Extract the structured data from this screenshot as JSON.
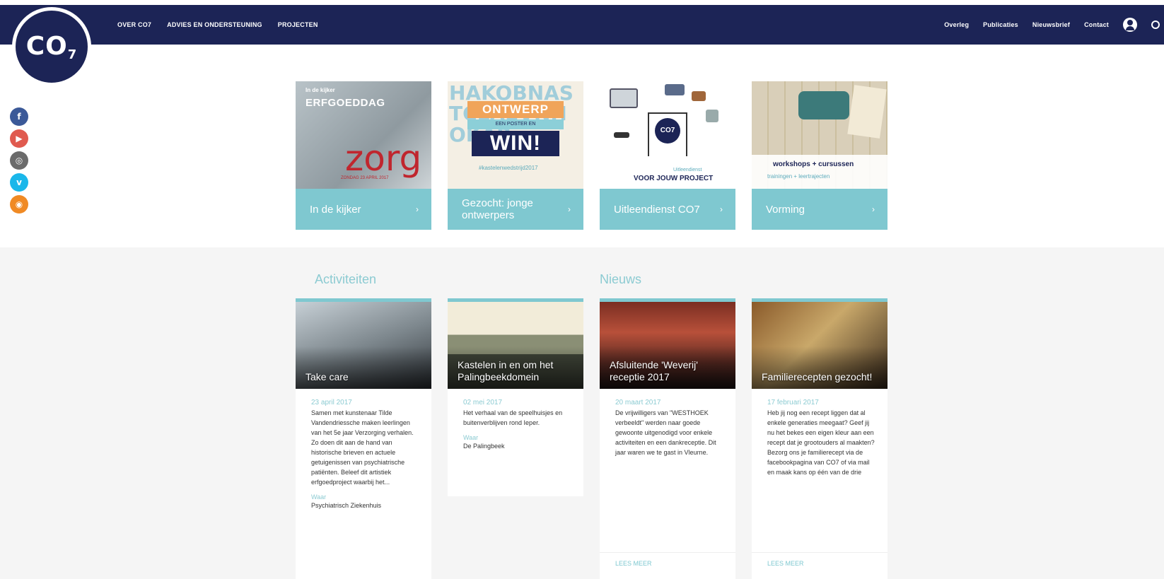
{
  "logo": {
    "text": "CO",
    "sub": "7"
  },
  "nav_left": [
    "OVER CO7",
    "ADVIES EN ONDERSTEUNING",
    "PROJECTEN"
  ],
  "nav_right": [
    "Overleg",
    "Publicaties",
    "Nieuwsbrief",
    "Contact"
  ],
  "social": [
    {
      "name": "facebook-icon",
      "glyph": "f",
      "color": "#3b5998"
    },
    {
      "name": "youtube-icon",
      "glyph": "▶",
      "color": "#e05a4f"
    },
    {
      "name": "instagram-icon",
      "glyph": "◎",
      "color": "#6b6b6b"
    },
    {
      "name": "vimeo-icon",
      "glyph": "v",
      "color": "#1ab7ea"
    },
    {
      "name": "rss-icon",
      "glyph": "◉",
      "color": "#f08a24"
    }
  ],
  "tiles": [
    {
      "label": "In de kijker",
      "kicker": "In de kijker",
      "head": "ERFGOEDDAG",
      "big": "zorg",
      "date": "ZONDAG 23 APRIL 2017"
    },
    {
      "label": "Gezocht: jonge ontwerpers",
      "lab1": "ONTWERP",
      "lab2": "EEN POSTER EN",
      "lab3": "WIN!",
      "hash": "#kastelenwedstrijd2017"
    },
    {
      "label": "Uitleendienst CO7",
      "circle": "CO7",
      "small": "Uitleendienst",
      "cap": "VOOR JOUW PROJECT"
    },
    {
      "label": "Vorming",
      "l1": "workshops + cursussen",
      "l2": "trainingen + leertrajecten"
    }
  ],
  "sections": {
    "activiteiten": "Activiteiten",
    "nieuws": "Nieuws"
  },
  "cards": [
    {
      "title": "Take care",
      "date": "23 april 2017",
      "text": "Samen met kunstenaar Tilde Vandendriessche maken leerlingen van het 5e jaar Verzorging verhalen. Zo doen dit aan de hand van historische brieven en actuele getuigenissen van psychiatrische patiënten. Beleef dit artistiek erfgoedproject waarbij het...",
      "where_label": "Waar",
      "where_value": "Psychiatrisch Ziekenhuis"
    },
    {
      "title": "Kastelen in en om het Palingbeekdomein",
      "date": "02 mei 2017",
      "text": "Het verhaal van de speelhuisjes en buitenverblijven rond Ieper.",
      "where_label": "Waar",
      "where_value": "De Palingbeek"
    },
    {
      "title": "Afsluitende 'Weverij' receptie 2017",
      "date": "20 maart 2017",
      "text": "De vrijwilligers van \"WESTHOEK verbeeldt\" werden naar goede gewoonte uitgenodigd voor enkele activiteiten en een dankreceptie. Dit jaar waren we te gast in Vleurne.",
      "more": "LEES MEER"
    },
    {
      "title": "Familierecepten gezocht!",
      "date": "17 februari 2017",
      "text": "Heb jij nog een recept liggen dat al enkele generaties meegaat? Geef jij nu het bekes een eigen kleur aan een recept dat je grootouders al maakten? Bezorg ons je familierecept via de facebookpagina van CO7 of via mail en maak kans op één van de drie",
      "more": "LEES MEER"
    }
  ]
}
